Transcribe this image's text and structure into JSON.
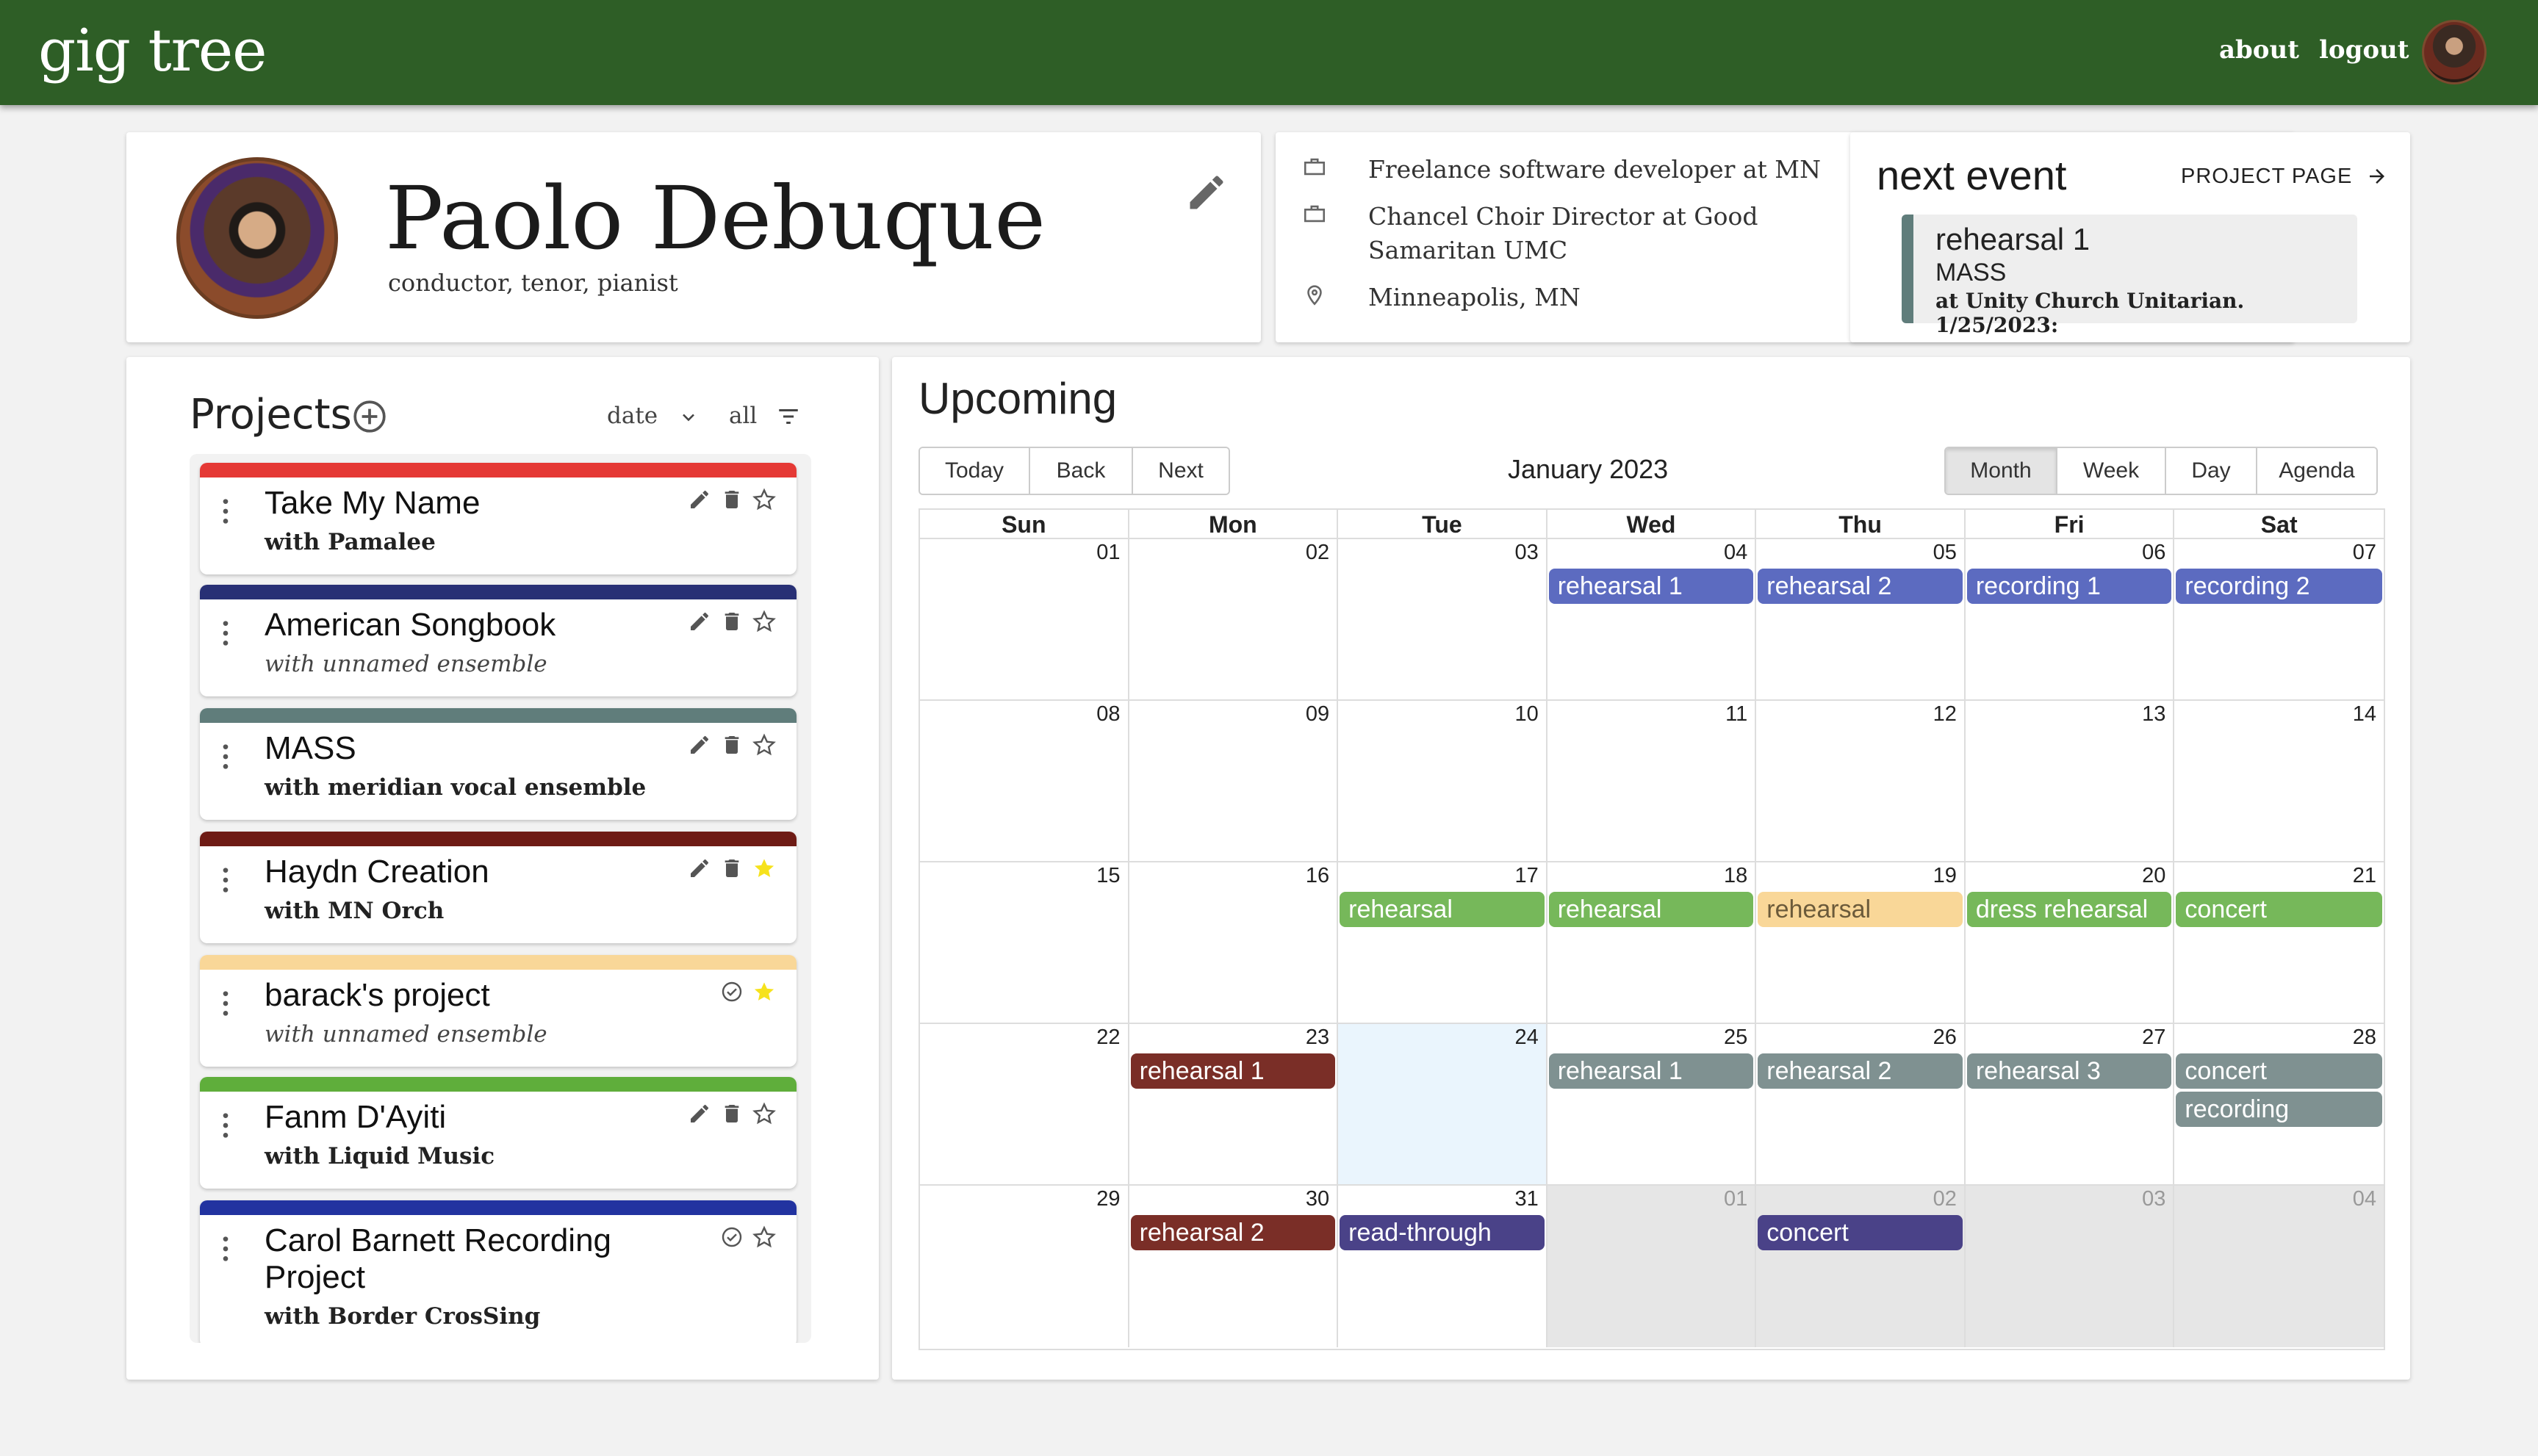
{
  "appbar": {
    "brand": "gig tree",
    "about": "about",
    "logout": "logout"
  },
  "profile": {
    "name": "Paolo Debuque",
    "subtitle": "conductor, tenor, pianist"
  },
  "info": {
    "job1": "Freelance software developer at MN",
    "job2": "Chancel Choir Director at Good Samaritan UMC",
    "location": "Minneapolis, MN"
  },
  "next_event": {
    "heading": "next event",
    "link": "PROJECT PAGE",
    "title": "rehearsal 1",
    "project": "MASS",
    "detail": "at Unity Church Unitarian. 1/25/2023:",
    "color": "#607d7b"
  },
  "projects": {
    "title": "Projects",
    "sort_label": "date",
    "filter_label": "all",
    "items": [
      {
        "name": "Take My Name",
        "with": "with Pamalee",
        "italic": false,
        "color": "#e53935",
        "starred": false,
        "mode": "edit"
      },
      {
        "name": "American Songbook",
        "with": "with unnamed ensemble",
        "italic": true,
        "color": "#283075",
        "starred": false,
        "mode": "edit"
      },
      {
        "name": "MASS",
        "with": "with meridian vocal ensemble",
        "italic": false,
        "color": "#607d7b",
        "starred": false,
        "mode": "edit"
      },
      {
        "name": "Haydn Creation",
        "with": "with MN Orch",
        "italic": false,
        "color": "#6e1b15",
        "starred": true,
        "mode": "edit"
      },
      {
        "name": "barack's project",
        "with": "with unnamed ensemble",
        "italic": true,
        "color": "#f9d798",
        "starred": true,
        "mode": "check"
      },
      {
        "name": "Fanm D'Ayiti",
        "with": "with Liquid Music",
        "italic": false,
        "color": "#5fae3b",
        "starred": false,
        "mode": "edit"
      },
      {
        "name": "Carol Barnett Recording Project",
        "with": "with Border CrosSing",
        "italic": false,
        "color": "#2233a0",
        "starred": false,
        "mode": "check"
      }
    ]
  },
  "calendar": {
    "title": "Upcoming",
    "nav": [
      "Today",
      "Back",
      "Next"
    ],
    "month_label": "January 2023",
    "views": [
      "Month",
      "Week",
      "Day",
      "Agenda"
    ],
    "active_view": "Month",
    "days_of_week": [
      "Sun",
      "Mon",
      "Tue",
      "Wed",
      "Thu",
      "Fri",
      "Sat"
    ],
    "weeks": [
      [
        "01",
        "02",
        "03",
        "04",
        "05",
        "06",
        "07"
      ],
      [
        "08",
        "09",
        "10",
        "11",
        "12",
        "13",
        "14"
      ],
      [
        "15",
        "16",
        "17",
        "18",
        "19",
        "20",
        "21"
      ],
      [
        "22",
        "23",
        "24",
        "25",
        "26",
        "27",
        "28"
      ],
      [
        "29",
        "30",
        "31",
        "01",
        "02",
        "03",
        "04"
      ]
    ],
    "off_cells": [
      [
        4,
        3
      ],
      [
        4,
        4
      ],
      [
        4,
        5
      ],
      [
        4,
        6
      ]
    ],
    "today_cell": [
      3,
      2
    ],
    "events": [
      {
        "week": 0,
        "day": 3,
        "slot": 0,
        "label": "rehearsal 1",
        "color": "#5c6bc0"
      },
      {
        "week": 0,
        "day": 4,
        "slot": 0,
        "label": "rehearsal 2",
        "color": "#5c6bc0"
      },
      {
        "week": 0,
        "day": 5,
        "slot": 0,
        "label": "recording 1",
        "color": "#5c6bc0"
      },
      {
        "week": 0,
        "day": 6,
        "slot": 0,
        "label": "recording 2",
        "color": "#5c6bc0"
      },
      {
        "week": 2,
        "day": 2,
        "slot": 0,
        "label": "rehearsal",
        "color": "#76b85a"
      },
      {
        "week": 2,
        "day": 3,
        "slot": 0,
        "label": "rehearsal",
        "color": "#76b85a"
      },
      {
        "week": 2,
        "day": 4,
        "slot": 0,
        "label": "rehearsal",
        "color": "#f9d798",
        "dark_text": true
      },
      {
        "week": 2,
        "day": 5,
        "slot": 0,
        "label": "dress rehearsal",
        "color": "#76b85a"
      },
      {
        "week": 2,
        "day": 6,
        "slot": 0,
        "label": "concert",
        "color": "#76b85a"
      },
      {
        "week": 3,
        "day": 1,
        "slot": 0,
        "label": "rehearsal 1",
        "color": "#7a2e27"
      },
      {
        "week": 3,
        "day": 3,
        "slot": 0,
        "label": "rehearsal 1",
        "color": "#7f9191"
      },
      {
        "week": 3,
        "day": 4,
        "slot": 0,
        "label": "rehearsal 2",
        "color": "#7f9191"
      },
      {
        "week": 3,
        "day": 5,
        "slot": 0,
        "label": "rehearsal 3",
        "color": "#7f9191"
      },
      {
        "week": 3,
        "day": 6,
        "slot": 0,
        "label": "concert",
        "color": "#7f9191"
      },
      {
        "week": 3,
        "day": 6,
        "slot": 1,
        "label": "recording",
        "color": "#7f9191"
      },
      {
        "week": 4,
        "day": 1,
        "slot": 0,
        "label": "rehearsal 2",
        "color": "#7a2e27"
      },
      {
        "week": 4,
        "day": 2,
        "slot": 0,
        "label": "read-through",
        "color": "#4a4288"
      },
      {
        "week": 4,
        "day": 4,
        "slot": 0,
        "label": "concert",
        "color": "#4a4288"
      }
    ]
  }
}
